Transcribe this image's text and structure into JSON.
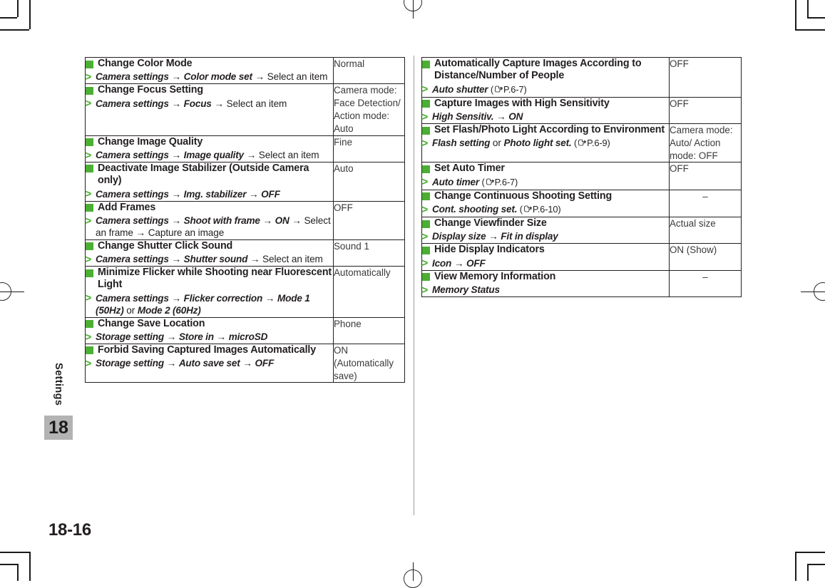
{
  "page": {
    "folio": "18-16",
    "chapter_label": "Settings",
    "chapter_number": "18",
    "accent_green": "#4caf34",
    "tab_gray": "#b3b3b3",
    "text_color": "#231f20"
  },
  "icons": {
    "bullet": "green-square-bullet",
    "operation": "green-greater-than-marker",
    "reference": "pointing-hand-icon",
    "arrow": "→"
  },
  "tables": {
    "left": {
      "rows": [
        {
          "heading": "Change Color Mode",
          "op_parts": [
            {
              "t": "Camera settings",
              "s": "bi"
            },
            {
              "t": " → ",
              "s": "arrow"
            },
            {
              "t": "Color mode set",
              "s": "bi"
            },
            {
              "t": " → ",
              "s": "arrow"
            },
            {
              "t": "Select an item",
              "s": "plain"
            }
          ],
          "value": "Normal"
        },
        {
          "heading": "Change Focus Setting",
          "op_parts": [
            {
              "t": "Camera settings",
              "s": "bi"
            },
            {
              "t": " → ",
              "s": "arrow"
            },
            {
              "t": "Focus",
              "s": "bi"
            },
            {
              "t": " → ",
              "s": "arrow"
            },
            {
              "t": "Select an item",
              "s": "plain"
            }
          ],
          "value": "Camera mode: Face Detection/ Action mode: Auto"
        },
        {
          "heading": "Change Image Quality",
          "op_parts": [
            {
              "t": "Camera settings",
              "s": "bi"
            },
            {
              "t": " → ",
              "s": "arrow"
            },
            {
              "t": "Image quality",
              "s": "bi"
            },
            {
              "t": " → ",
              "s": "arrow"
            },
            {
              "t": "Select an item",
              "s": "plain"
            }
          ],
          "value": "Fine"
        },
        {
          "heading": "Deactivate Image Stabilizer (Outside Camera only)",
          "op_parts": [
            {
              "t": "Camera settings",
              "s": "bi"
            },
            {
              "t": " → ",
              "s": "arrow"
            },
            {
              "t": "Img. stabilizer",
              "s": "bi"
            },
            {
              "t": " → ",
              "s": "arrow"
            },
            {
              "t": "OFF",
              "s": "bi"
            }
          ],
          "value": "Auto"
        },
        {
          "heading": "Add Frames",
          "op_parts": [
            {
              "t": "Camera settings",
              "s": "bi"
            },
            {
              "t": " → ",
              "s": "arrow"
            },
            {
              "t": "Shoot with frame",
              "s": "bi"
            },
            {
              "t": " → ",
              "s": "arrow"
            },
            {
              "t": "ON",
              "s": "bi"
            },
            {
              "t": " → ",
              "s": "arrow"
            },
            {
              "t": "Select an frame",
              "s": "plain"
            },
            {
              "t": " → ",
              "s": "arrow"
            },
            {
              "t": "Capture an image",
              "s": "plain"
            }
          ],
          "value": "OFF"
        },
        {
          "heading": "Change Shutter Click Sound",
          "op_parts": [
            {
              "t": "Camera settings",
              "s": "bi"
            },
            {
              "t": " → ",
              "s": "arrow"
            },
            {
              "t": "Shutter sound",
              "s": "bi"
            },
            {
              "t": " → ",
              "s": "arrow"
            },
            {
              "t": "Select an item",
              "s": "plain"
            }
          ],
          "value": "Sound 1"
        },
        {
          "heading": "Minimize Flicker while Shooting near Fluorescent Light",
          "op_parts": [
            {
              "t": "Camera settings",
              "s": "bi"
            },
            {
              "t": " → ",
              "s": "arrow"
            },
            {
              "t": "Flicker correction",
              "s": "bi"
            },
            {
              "t": " → ",
              "s": "arrow"
            },
            {
              "t": "Mode 1 (50Hz)",
              "s": "bi"
            },
            {
              "t": " or ",
              "s": "plain"
            },
            {
              "t": "Mode 2 (60Hz)",
              "s": "bi"
            }
          ],
          "value": "Automatically"
        },
        {
          "heading": "Change Save Location",
          "op_parts": [
            {
              "t": "Storage setting",
              "s": "bi"
            },
            {
              "t": " → ",
              "s": "arrow"
            },
            {
              "t": "Store in",
              "s": "bi"
            },
            {
              "t": " → ",
              "s": "arrow"
            },
            {
              "t": "microSD",
              "s": "bi"
            }
          ],
          "value": "Phone"
        },
        {
          "heading": "Forbid Saving Captured Images Automatically",
          "op_parts": [
            {
              "t": "Storage setting",
              "s": "bi"
            },
            {
              "t": " → ",
              "s": "arrow"
            },
            {
              "t": "Auto save set",
              "s": "bi"
            },
            {
              "t": " → ",
              "s": "arrow"
            },
            {
              "t": "OFF",
              "s": "bi"
            }
          ],
          "value": "ON (Automatically save)"
        }
      ]
    },
    "right": {
      "rows": [
        {
          "heading": "Automatically Capture Images According to Distance/Number of People",
          "op_parts": [
            {
              "t": "Auto shutter",
              "s": "bi"
            },
            {
              "t": " (",
              "s": "ref"
            },
            {
              "t": "HAND",
              "s": "icon"
            },
            {
              "t": "P.6-7)",
              "s": "ref"
            }
          ],
          "value": "OFF"
        },
        {
          "heading": "Capture Images with High Sensitivity",
          "op_parts": [
            {
              "t": "High Sensitiv.",
              "s": "bi"
            },
            {
              "t": " → ",
              "s": "arrow"
            },
            {
              "t": "ON",
              "s": "bi"
            }
          ],
          "value": "OFF"
        },
        {
          "heading": "Set Flash/Photo Light According to Environment",
          "op_parts": [
            {
              "t": "Flash setting",
              "s": "bi"
            },
            {
              "t": " or ",
              "s": "plain"
            },
            {
              "t": "Photo light set.",
              "s": "bi"
            },
            {
              "t": " (",
              "s": "ref"
            },
            {
              "t": "HAND",
              "s": "icon"
            },
            {
              "t": "P.6-9)",
              "s": "ref"
            }
          ],
          "value": "Camera mode: Auto/ Action mode: OFF"
        },
        {
          "heading": "Set Auto Timer",
          "op_parts": [
            {
              "t": "Auto timer",
              "s": "bi"
            },
            {
              "t": " (",
              "s": "ref"
            },
            {
              "t": "HAND",
              "s": "icon"
            },
            {
              "t": "P.6-7)",
              "s": "ref"
            }
          ],
          "value": "OFF"
        },
        {
          "heading": "Change Continuous Shooting Setting",
          "op_parts": [
            {
              "t": "Cont. shooting set.",
              "s": "bi"
            },
            {
              "t": " (",
              "s": "ref"
            },
            {
              "t": "HAND",
              "s": "icon"
            },
            {
              "t": "P.6-10)",
              "s": "ref"
            }
          ],
          "value": "–"
        },
        {
          "heading": "Change Viewfinder Size",
          "op_parts": [
            {
              "t": "Display size",
              "s": "bi"
            },
            {
              "t": " → ",
              "s": "arrow"
            },
            {
              "t": "Fit in display",
              "s": "bi"
            }
          ],
          "value": "Actual size"
        },
        {
          "heading": "Hide Display Indicators",
          "op_parts": [
            {
              "t": "Icon",
              "s": "bi"
            },
            {
              "t": " → ",
              "s": "arrow"
            },
            {
              "t": "OFF",
              "s": "bi"
            }
          ],
          "value": "ON (Show)"
        },
        {
          "heading": "View Memory Information",
          "op_parts": [
            {
              "t": "Memory Status",
              "s": "bi"
            }
          ],
          "value": "–"
        }
      ]
    }
  }
}
